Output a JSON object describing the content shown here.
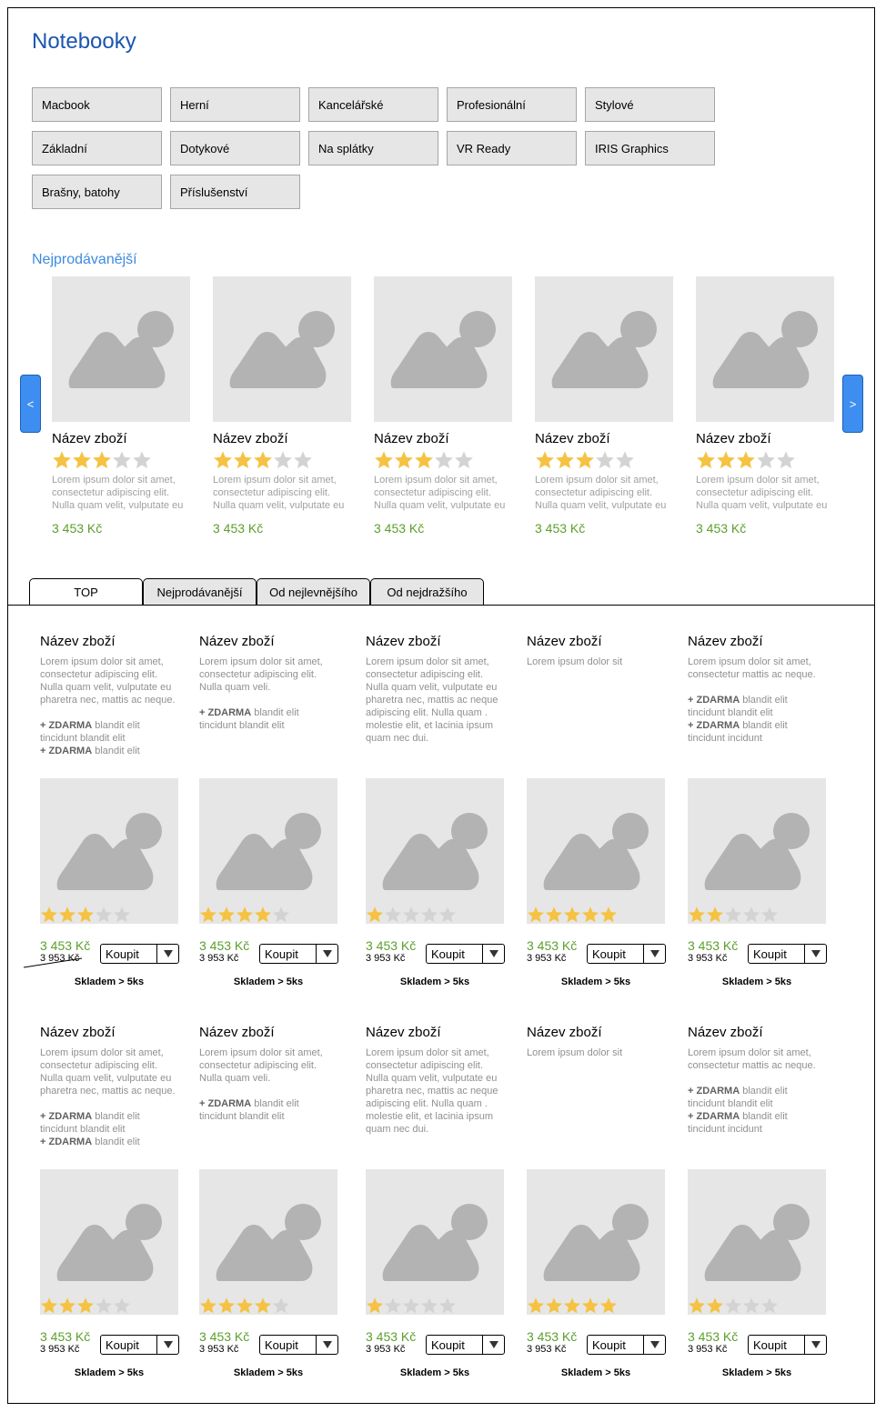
{
  "title": "Notebooky",
  "categories": [
    "Macbook",
    "Herní",
    "Kancelářské",
    "Profesionální",
    "Stylové",
    "Základní",
    "Dotykové",
    "Na splátky",
    "VR Ready",
    "IRIS Graphics",
    "Brašny, batohy",
    "Příslušenství"
  ],
  "bestsellers": {
    "title": "Nejprodávanější",
    "prev_label": "<",
    "next_label": ">",
    "items": [
      {
        "name": "Název zboží",
        "rating": 3,
        "desc": "Lorem ipsum dolor sit amet, consectetur adipiscing elit. Nulla quam velit, vulputate eu",
        "price": "3 453 Kč"
      },
      {
        "name": "Název zboží",
        "rating": 3,
        "desc": "Lorem ipsum dolor sit amet, consectetur adipiscing elit. Nulla quam velit, vulputate eu",
        "price": "3 453 Kč"
      },
      {
        "name": "Název zboží",
        "rating": 3,
        "desc": "Lorem ipsum dolor sit amet, consectetur adipiscing elit. Nulla quam velit, vulputate eu",
        "price": "3 453 Kč"
      },
      {
        "name": "Název zboží",
        "rating": 3,
        "desc": "Lorem ipsum dolor sit amet, consectetur adipiscing elit. Nulla quam velit, vulputate eu",
        "price": "3 453 Kč"
      },
      {
        "name": "Název zboží",
        "rating": 3,
        "desc": "Lorem ipsum dolor sit amet, consectetur adipiscing elit. Nulla quam velit, vulputate eu",
        "price": "3 453 Kč"
      }
    ]
  },
  "tabs": [
    "TOP",
    "Nejprodávanější",
    "Od nejlevnějšího",
    "Od nejdražšího"
  ],
  "colors": {
    "accent": "#1a55b0",
    "price": "#5aa02c",
    "star_on": "#f5c242",
    "star_off": "#d3d3d3",
    "arrow": "#3d8ef0"
  },
  "products": [
    {
      "name": "Název zboží",
      "desc": "Lorem ipsum dolor sit amet, consectetur adipiscing elit. Nulla quam velit, vulputate eu pharetra nec, mattis ac neque.",
      "extras": [
        "+ ZDARMA blandit elit tincidunt blandit elit",
        "+ ZDARMA blandit elit"
      ],
      "rating": 3,
      "price": "3 453 Kč",
      "old_price": "3 953 Kč",
      "buy": "Koupit",
      "stock": "Skladem > 5ks"
    },
    {
      "name": "Název zboží",
      "desc": "Lorem ipsum dolor sit amet, consectetur adipiscing elit. Nulla quam veli.",
      "extras": [
        "+ ZDARMA blandit elit tincidunt blandit elit"
      ],
      "rating": 4,
      "price": "3 453 Kč",
      "old_price": "3 953 Kč",
      "buy": "Koupit",
      "stock": "Skladem > 5ks"
    },
    {
      "name": "Název zboží",
      "desc": "Lorem ipsum dolor sit amet, consectetur adipiscing elit. Nulla quam velit, vulputate eu pharetra nec, mattis ac neque adipiscing elit. Nulla quam . molestie elit, et lacinia ipsum quam nec dui.",
      "extras": [],
      "rating": 1,
      "price": "3 453 Kč",
      "old_price": "3 953 Kč",
      "buy": "Koupit",
      "stock": "Skladem > 5ks"
    },
    {
      "name": "Název zboží",
      "desc": "Lorem ipsum dolor sit",
      "extras": [],
      "rating": 5,
      "price": "3 453 Kč",
      "old_price": "3 953 Kč",
      "buy": "Koupit",
      "stock": "Skladem > 5ks"
    },
    {
      "name": "Název zboží",
      "desc": "Lorem ipsum dolor sit amet, consectetur mattis ac neque.",
      "extras": [
        "+ ZDARMA blandit elit tincidunt blandit elit",
        "+ ZDARMA blandit elit tincidunt incidunt"
      ],
      "rating": 2,
      "price": "3 453 Kč",
      "old_price": "3 953 Kč",
      "buy": "Koupit",
      "stock": "Skladem > 5ks"
    },
    {
      "name": "Název zboží",
      "desc": "Lorem ipsum dolor sit amet, consectetur adipiscing elit. Nulla quam velit, vulputate eu pharetra nec, mattis ac neque.",
      "extras": [
        "+ ZDARMA blandit elit tincidunt blandit elit",
        "+ ZDARMA blandit elit"
      ],
      "rating": 3,
      "price": "3 453 Kč",
      "old_price": "3 953 Kč",
      "buy": "Koupit",
      "stock": "Skladem > 5ks"
    },
    {
      "name": "Název zboží",
      "desc": "Lorem ipsum dolor sit amet, consectetur adipiscing elit. Nulla quam veli.",
      "extras": [
        "+ ZDARMA blandit elit tincidunt blandit elit"
      ],
      "rating": 4,
      "price": "3 453 Kč",
      "old_price": "3 953 Kč",
      "buy": "Koupit",
      "stock": "Skladem > 5ks"
    },
    {
      "name": "Název zboží",
      "desc": "Lorem ipsum dolor sit amet, consectetur adipiscing elit. Nulla quam velit, vulputate eu pharetra nec, mattis ac neque adipiscing elit. Nulla quam . molestie elit, et lacinia ipsum quam nec dui.",
      "extras": [],
      "rating": 1,
      "price": "3 453 Kč",
      "old_price": "3 953 Kč",
      "buy": "Koupit",
      "stock": "Skladem > 5ks"
    },
    {
      "name": "Název zboží",
      "desc": "Lorem ipsum dolor sit",
      "extras": [],
      "rating": 5,
      "price": "3 453 Kč",
      "old_price": "3 953 Kč",
      "buy": "Koupit",
      "stock": "Skladem > 5ks"
    },
    {
      "name": "Název zboží",
      "desc": "Lorem ipsum dolor sit amet, consectetur mattis ac neque.",
      "extras": [
        "+ ZDARMA blandit elit tincidunt blandit elit",
        "+ ZDARMA blandit elit tincidunt incidunt"
      ],
      "rating": 2,
      "price": "3 453 Kč",
      "old_price": "3 953 Kč",
      "buy": "Koupit",
      "stock": "Skladem > 5ks"
    }
  ]
}
